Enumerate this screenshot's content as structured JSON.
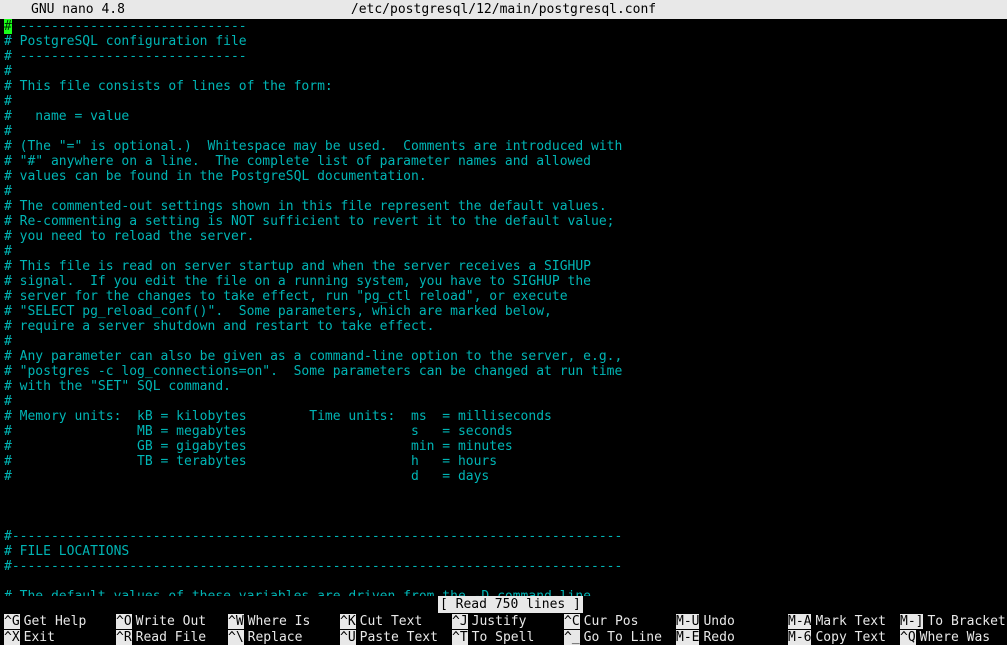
{
  "titlebar": {
    "version": "GNU nano 4.8",
    "filepath": "/etc/postgresql/12/main/postgresql.conf",
    "modified": ""
  },
  "editor": {
    "cursor_char": "#",
    "lines": [
      "# -----------------------------",
      "# PostgreSQL configuration file",
      "# -----------------------------",
      "#",
      "# This file consists of lines of the form:",
      "#",
      "#   name = value",
      "#",
      "# (The \"=\" is optional.)  Whitespace may be used.  Comments are introduced with",
      "# \"#\" anywhere on a line.  The complete list of parameter names and allowed",
      "# values can be found in the PostgreSQL documentation.",
      "#",
      "# The commented-out settings shown in this file represent the default values.",
      "# Re-commenting a setting is NOT sufficient to revert it to the default value;",
      "# you need to reload the server.",
      "#",
      "# This file is read on server startup and when the server receives a SIGHUP",
      "# signal.  If you edit the file on a running system, you have to SIGHUP the",
      "# server for the changes to take effect, run \"pg_ctl reload\", or execute",
      "# \"SELECT pg_reload_conf()\".  Some parameters, which are marked below,",
      "# require a server shutdown and restart to take effect.",
      "#",
      "# Any parameter can also be given as a command-line option to the server, e.g.,",
      "# \"postgres -c log_connections=on\".  Some parameters can be changed at run time",
      "# with the \"SET\" SQL command.",
      "#",
      "# Memory units:  kB = kilobytes        Time units:  ms  = milliseconds",
      "#                MB = megabytes                     s   = seconds",
      "#                GB = gigabytes                     min = minutes",
      "#                TB = terabytes                     h   = hours",
      "#                                                   d   = days",
      "",
      "",
      "",
      "#------------------------------------------------------------------------------",
      "# FILE LOCATIONS",
      "#------------------------------------------------------------------------------",
      "",
      "# The default values of these variables are driven from the -D command-line"
    ]
  },
  "status": {
    "message": "[ Read 750 lines ]"
  },
  "shortcuts": {
    "row1": [
      {
        "key": "^G",
        "label": "Get Help"
      },
      {
        "key": "^O",
        "label": "Write Out"
      },
      {
        "key": "^W",
        "label": "Where Is"
      },
      {
        "key": "^K",
        "label": "Cut Text"
      },
      {
        "key": "^J",
        "label": "Justify"
      },
      {
        "key": "^C",
        "label": "Cur Pos"
      },
      {
        "key": "M-U",
        "label": "Undo"
      },
      {
        "key": "M-A",
        "label": "Mark Text"
      },
      {
        "key": "M-]",
        "label": "To Bracket"
      }
    ],
    "row2": [
      {
        "key": "^X",
        "label": "Exit"
      },
      {
        "key": "^R",
        "label": "Read File"
      },
      {
        "key": "^\\",
        "label": "Replace"
      },
      {
        "key": "^U",
        "label": "Paste Text"
      },
      {
        "key": "^T",
        "label": "To Spell"
      },
      {
        "key": "^_",
        "label": "Go To Line"
      },
      {
        "key": "M-E",
        "label": "Redo"
      },
      {
        "key": "M-6",
        "label": "Copy Text"
      },
      {
        "key": "^Q",
        "label": "Where Was"
      }
    ]
  },
  "colors": {
    "background": "#000000",
    "comment_text": "#00b5b5",
    "titlebar_bg": "#e8e8e8",
    "cursor_bg": "#1aff1a",
    "shortcut_text": "#e8e8e8"
  }
}
